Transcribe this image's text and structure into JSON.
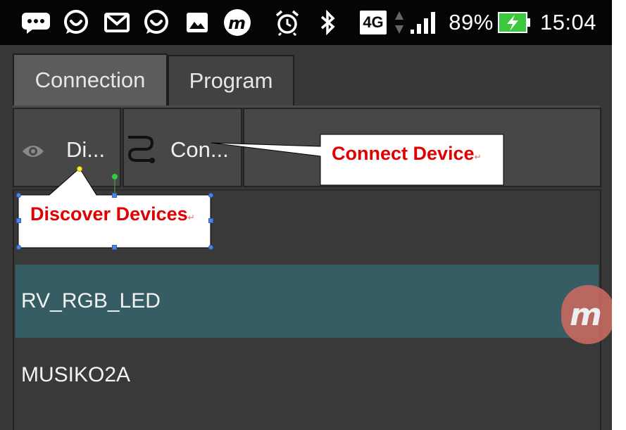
{
  "status_bar": {
    "icons": [
      "chat-bubble-icon",
      "whatsapp-icon",
      "gmail-icon",
      "whatsapp-icon",
      "gallery-icon",
      "musiko-icon",
      "alarm-icon",
      "bluetooth-icon",
      "network-4g-icon",
      "signal-icon"
    ],
    "network_label": "4G",
    "battery_percent": "89%",
    "time": "15:04"
  },
  "tabs": [
    {
      "label": "Connection",
      "active": true
    },
    {
      "label": "Program",
      "active": false
    }
  ],
  "toolbar": {
    "discover_label": "Di...",
    "discover_icon": "eye-icon",
    "connect_label": "Con...",
    "connect_icon": "connect-path-icon"
  },
  "devices": [
    {
      "name": "RV_RGB_LED",
      "selected": true
    },
    {
      "name": "MUSIKO2A",
      "selected": false
    }
  ],
  "float_badge": {
    "icon": "musiko-icon",
    "label": "m"
  },
  "callouts": {
    "discover": {
      "text": "Discover Devices",
      "mark": "↵"
    },
    "connect": {
      "text": "Connect Device",
      "mark": "↵"
    }
  },
  "colors": {
    "status_bar_bg": "#050505",
    "app_bg": "#373737",
    "selected_row": "#365c64",
    "callout_text": "#e00000",
    "battery_green": "#3cc83c"
  }
}
